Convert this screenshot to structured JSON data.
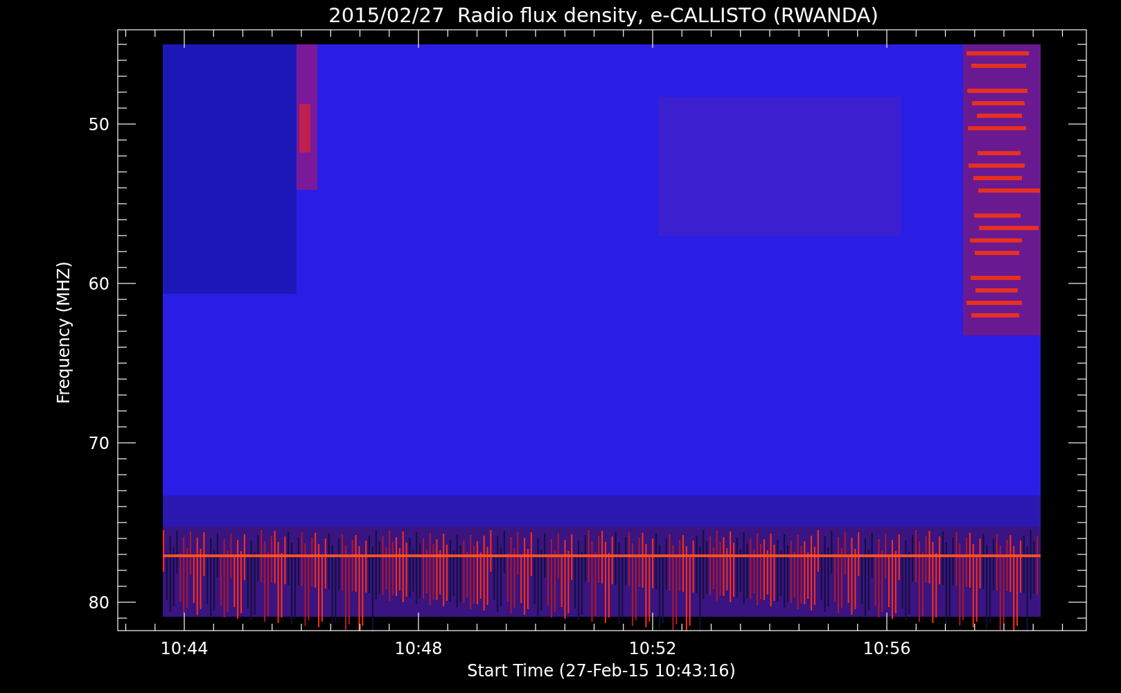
{
  "title": "2015/02/27  Radio flux density, e-CALLISTO (RWANDA)",
  "y_axis": {
    "label": "Frequency (MHZ)",
    "ticks": [
      "50",
      "60",
      "70",
      "80"
    ]
  },
  "x_axis": {
    "label": "Start Time (27-Feb-15 10:43:16)",
    "ticks": [
      "10:44",
      "10:48",
      "10:52",
      "10:56"
    ]
  }
}
